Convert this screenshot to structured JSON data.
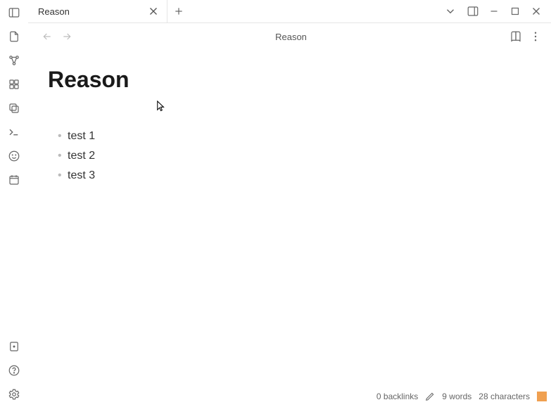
{
  "tab": {
    "label": "Reason"
  },
  "breadcrumb": {
    "title": "Reason"
  },
  "note": {
    "title": "Reason",
    "bullets": [
      "test 1",
      "test 2",
      "test 3"
    ]
  },
  "status": {
    "backlinks_label": "0 backlinks",
    "words_label": "9 words",
    "chars_label": "28 characters"
  }
}
